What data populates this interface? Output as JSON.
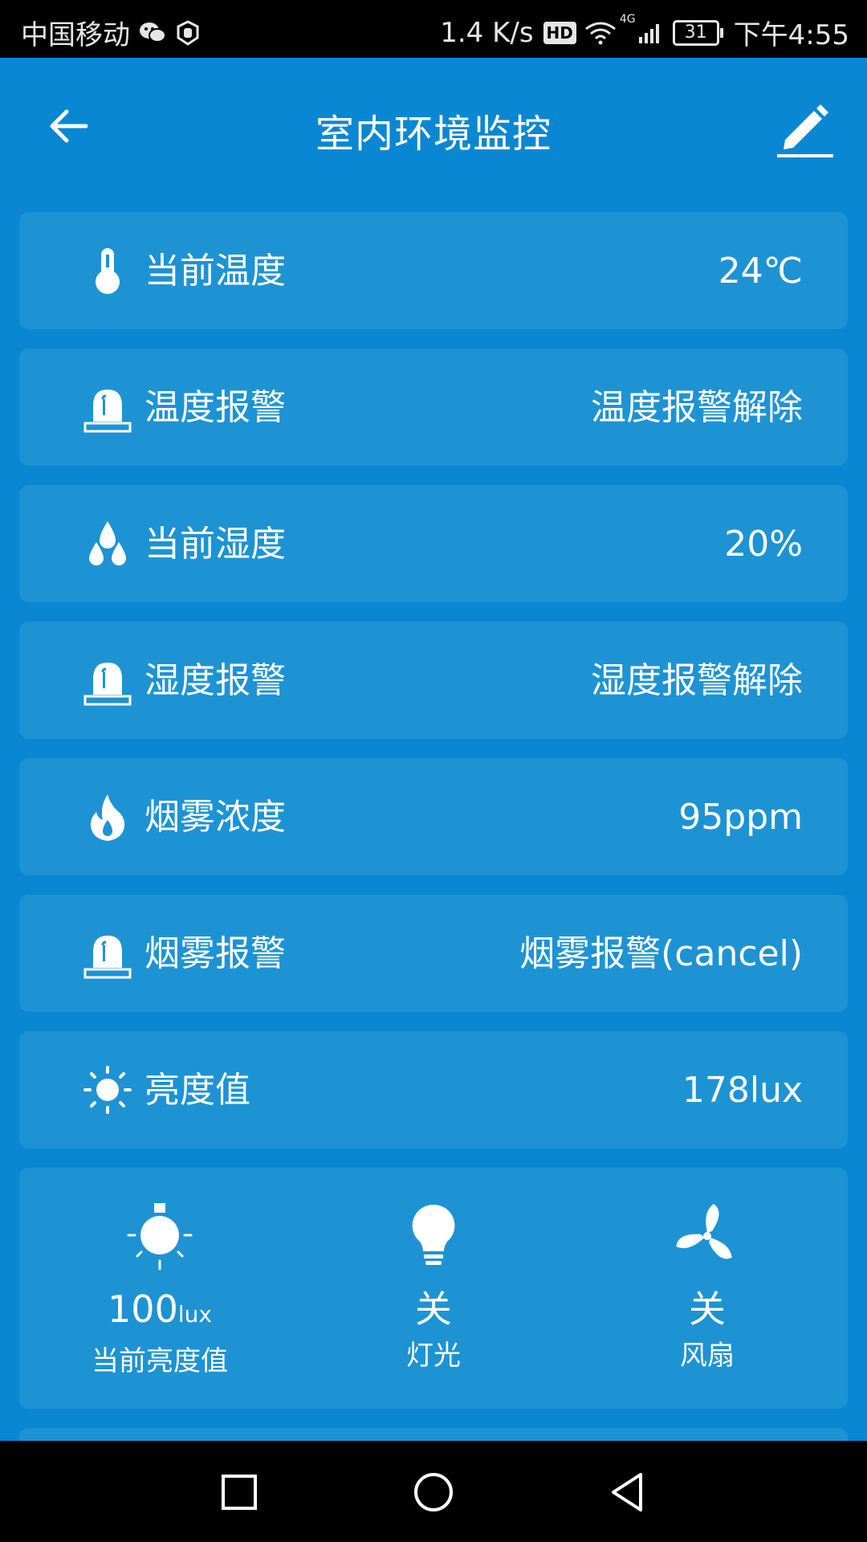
{
  "status_bar": {
    "carrier": "中国移动",
    "speed": "1.4 K/s",
    "hd": "HD",
    "network": "4G",
    "battery": "31",
    "time": "下午4:55"
  },
  "header": {
    "title": "室内环境监控"
  },
  "rows": [
    {
      "icon": "thermometer-icon",
      "label": "当前温度",
      "value": "24℃"
    },
    {
      "icon": "alarm-siren-icon",
      "label": "温度报警",
      "value": "温度报警解除"
    },
    {
      "icon": "water-drops-icon",
      "label": "当前湿度",
      "value": "20%"
    },
    {
      "icon": "alarm-siren-icon",
      "label": "湿度报警",
      "value": "湿度报警解除"
    },
    {
      "icon": "flame-icon",
      "label": "烟雾浓度",
      "value": "95ppm"
    },
    {
      "icon": "alarm-siren-icon",
      "label": "烟雾报警",
      "value": "烟雾报警(cancel)"
    },
    {
      "icon": "sun-icon",
      "label": "亮度值",
      "value": "178lux"
    }
  ],
  "devices": [
    {
      "icon": "light-bulb-glow-icon",
      "value": "100",
      "unit": "lux",
      "label": "当前亮度值"
    },
    {
      "icon": "bulb-icon",
      "value": "关",
      "label": "灯光"
    },
    {
      "icon": "fan-icon",
      "value": "关",
      "label": "风扇"
    }
  ],
  "colors": {
    "background": "#0a87d3",
    "card": "#1d93d4",
    "text": "#ffffff"
  }
}
